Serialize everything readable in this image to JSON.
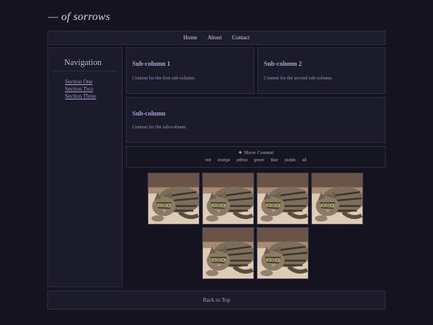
{
  "site": {
    "title": "— of sorrows"
  },
  "nav": {
    "items": [
      "Home",
      "About",
      "Contact"
    ]
  },
  "sidebar": {
    "title": "Navigation",
    "links": [
      "Section One",
      "Section Two",
      "Section Three"
    ]
  },
  "panels": {
    "sub1": {
      "title": "Sub-column 1",
      "text": "Content for the first sub-column."
    },
    "sub2": {
      "title": "Sub-column 2",
      "text": "Content for the second sub-column."
    },
    "sub3": {
      "title": "Sub-column",
      "text": "Content for the sub-column."
    }
  },
  "gallery": {
    "toggle_label": "★ Show Content",
    "filters": [
      "red",
      "orange",
      "yellow",
      "green",
      "blue",
      "purple",
      "all"
    ],
    "image_count": 6
  },
  "footer": {
    "back_to_top": "Back to Top"
  }
}
